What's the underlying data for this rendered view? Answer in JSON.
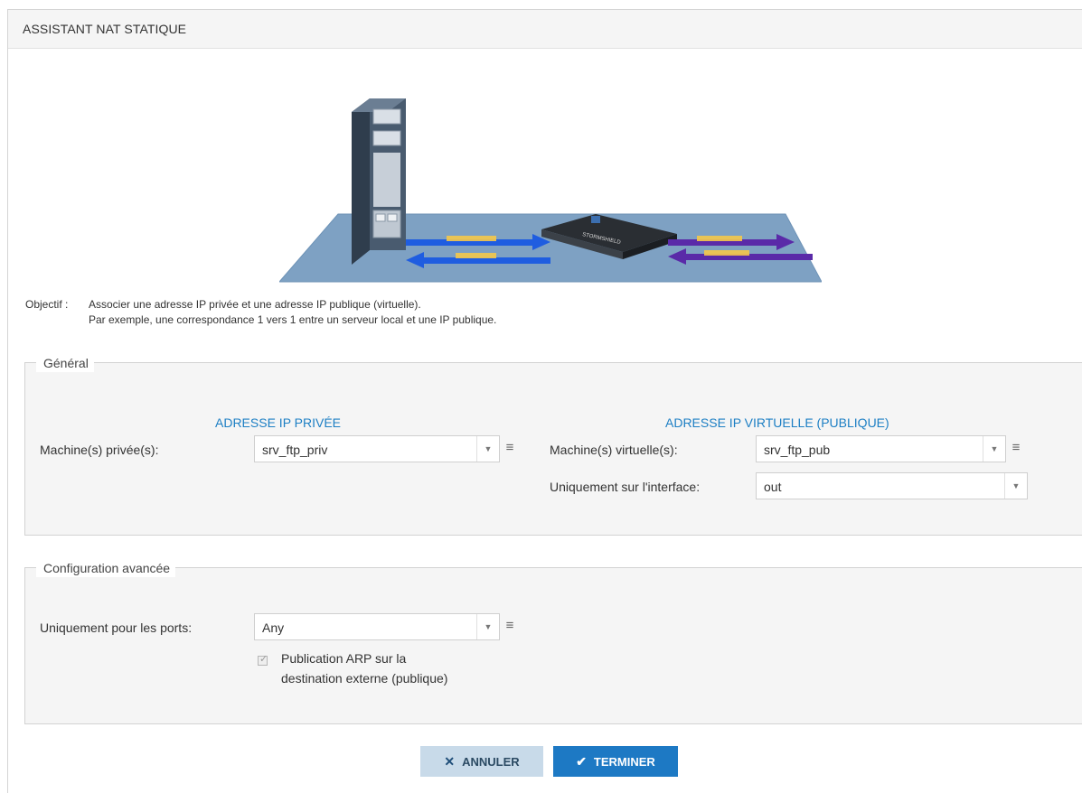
{
  "window": {
    "title": "ASSISTANT NAT STATIQUE"
  },
  "objective": {
    "label": "Objectif :",
    "line1": "Associer une adresse IP privée et une adresse IP publique (virtuelle).",
    "line2": "Par exemple, une correspondance 1 vers 1 entre un serveur local et une IP publique."
  },
  "general": {
    "legend": "Général",
    "private_title": "ADRESSE IP PRIVÉE",
    "public_title": "ADRESSE IP VIRTUELLE (PUBLIQUE)",
    "private_label": "Machine(s) privée(s):",
    "private_value": "srv_ftp_priv",
    "virtual_label": "Machine(s) virtuelle(s):",
    "virtual_value": "srv_ftp_pub",
    "interface_label": "Uniquement sur l'interface:",
    "interface_value": "out"
  },
  "advanced": {
    "legend": "Configuration avancée",
    "ports_label": "Uniquement pour les ports:",
    "ports_value": "Any",
    "arp_label_line1": "Publication ARP sur la",
    "arp_label_line2": "destination externe (publique)",
    "arp_checked": true
  },
  "buttons": {
    "cancel": "ANNULER",
    "finish": "TERMINER"
  },
  "colors": {
    "accent": "#1d79c4",
    "cancel_bg": "#c8dae9",
    "panel_bg": "#f5f5f5"
  }
}
